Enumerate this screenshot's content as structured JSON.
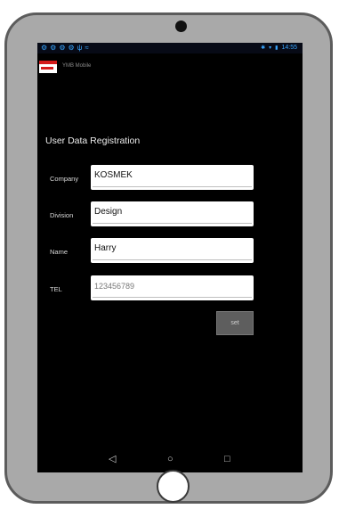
{
  "status_bar": {
    "left_icons": [
      "notification-icon",
      "notification-icon",
      "notification-icon",
      "notification-icon",
      "usb-icon",
      "wifi-icon"
    ],
    "clock": "14:55"
  },
  "app": {
    "title": "YMB Mobile"
  },
  "form": {
    "title": "User Data Registration",
    "fields": [
      {
        "label": "Company",
        "value": "KOSMEK"
      },
      {
        "label": "Division",
        "value": "Design"
      },
      {
        "label": "Name",
        "value": "Harry"
      },
      {
        "label": "TEL",
        "value": "123456789"
      }
    ],
    "submit_label": "set"
  },
  "nav": {
    "back_icon": "back-icon",
    "home_icon": "home-icon",
    "recents_icon": "recents-icon"
  },
  "colors": {
    "screen_bg": "#000000",
    "tablet_bezel": "#a9a9a9",
    "brand_red": "#d41a1a",
    "status_blue": "#38a6ff"
  }
}
